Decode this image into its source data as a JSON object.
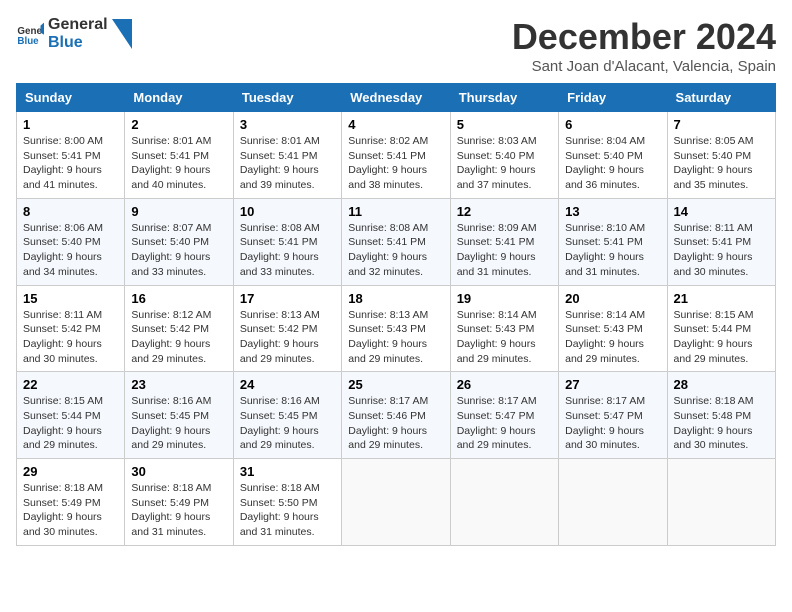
{
  "header": {
    "logo_general": "General",
    "logo_blue": "Blue",
    "month": "December 2024",
    "location": "Sant Joan d'Alacant, Valencia, Spain"
  },
  "days_of_week": [
    "Sunday",
    "Monday",
    "Tuesday",
    "Wednesday",
    "Thursday",
    "Friday",
    "Saturday"
  ],
  "weeks": [
    [
      {
        "day": "1",
        "sunrise": "Sunrise: 8:00 AM",
        "sunset": "Sunset: 5:41 PM",
        "daylight": "Daylight: 9 hours and 41 minutes."
      },
      {
        "day": "2",
        "sunrise": "Sunrise: 8:01 AM",
        "sunset": "Sunset: 5:41 PM",
        "daylight": "Daylight: 9 hours and 40 minutes."
      },
      {
        "day": "3",
        "sunrise": "Sunrise: 8:01 AM",
        "sunset": "Sunset: 5:41 PM",
        "daylight": "Daylight: 9 hours and 39 minutes."
      },
      {
        "day": "4",
        "sunrise": "Sunrise: 8:02 AM",
        "sunset": "Sunset: 5:41 PM",
        "daylight": "Daylight: 9 hours and 38 minutes."
      },
      {
        "day": "5",
        "sunrise": "Sunrise: 8:03 AM",
        "sunset": "Sunset: 5:40 PM",
        "daylight": "Daylight: 9 hours and 37 minutes."
      },
      {
        "day": "6",
        "sunrise": "Sunrise: 8:04 AM",
        "sunset": "Sunset: 5:40 PM",
        "daylight": "Daylight: 9 hours and 36 minutes."
      },
      {
        "day": "7",
        "sunrise": "Sunrise: 8:05 AM",
        "sunset": "Sunset: 5:40 PM",
        "daylight": "Daylight: 9 hours and 35 minutes."
      }
    ],
    [
      {
        "day": "8",
        "sunrise": "Sunrise: 8:06 AM",
        "sunset": "Sunset: 5:40 PM",
        "daylight": "Daylight: 9 hours and 34 minutes."
      },
      {
        "day": "9",
        "sunrise": "Sunrise: 8:07 AM",
        "sunset": "Sunset: 5:40 PM",
        "daylight": "Daylight: 9 hours and 33 minutes."
      },
      {
        "day": "10",
        "sunrise": "Sunrise: 8:08 AM",
        "sunset": "Sunset: 5:41 PM",
        "daylight": "Daylight: 9 hours and 33 minutes."
      },
      {
        "day": "11",
        "sunrise": "Sunrise: 8:08 AM",
        "sunset": "Sunset: 5:41 PM",
        "daylight": "Daylight: 9 hours and 32 minutes."
      },
      {
        "day": "12",
        "sunrise": "Sunrise: 8:09 AM",
        "sunset": "Sunset: 5:41 PM",
        "daylight": "Daylight: 9 hours and 31 minutes."
      },
      {
        "day": "13",
        "sunrise": "Sunrise: 8:10 AM",
        "sunset": "Sunset: 5:41 PM",
        "daylight": "Daylight: 9 hours and 31 minutes."
      },
      {
        "day": "14",
        "sunrise": "Sunrise: 8:11 AM",
        "sunset": "Sunset: 5:41 PM",
        "daylight": "Daylight: 9 hours and 30 minutes."
      }
    ],
    [
      {
        "day": "15",
        "sunrise": "Sunrise: 8:11 AM",
        "sunset": "Sunset: 5:42 PM",
        "daylight": "Daylight: 9 hours and 30 minutes."
      },
      {
        "day": "16",
        "sunrise": "Sunrise: 8:12 AM",
        "sunset": "Sunset: 5:42 PM",
        "daylight": "Daylight: 9 hours and 29 minutes."
      },
      {
        "day": "17",
        "sunrise": "Sunrise: 8:13 AM",
        "sunset": "Sunset: 5:42 PM",
        "daylight": "Daylight: 9 hours and 29 minutes."
      },
      {
        "day": "18",
        "sunrise": "Sunrise: 8:13 AM",
        "sunset": "Sunset: 5:43 PM",
        "daylight": "Daylight: 9 hours and 29 minutes."
      },
      {
        "day": "19",
        "sunrise": "Sunrise: 8:14 AM",
        "sunset": "Sunset: 5:43 PM",
        "daylight": "Daylight: 9 hours and 29 minutes."
      },
      {
        "day": "20",
        "sunrise": "Sunrise: 8:14 AM",
        "sunset": "Sunset: 5:43 PM",
        "daylight": "Daylight: 9 hours and 29 minutes."
      },
      {
        "day": "21",
        "sunrise": "Sunrise: 8:15 AM",
        "sunset": "Sunset: 5:44 PM",
        "daylight": "Daylight: 9 hours and 29 minutes."
      }
    ],
    [
      {
        "day": "22",
        "sunrise": "Sunrise: 8:15 AM",
        "sunset": "Sunset: 5:44 PM",
        "daylight": "Daylight: 9 hours and 29 minutes."
      },
      {
        "day": "23",
        "sunrise": "Sunrise: 8:16 AM",
        "sunset": "Sunset: 5:45 PM",
        "daylight": "Daylight: 9 hours and 29 minutes."
      },
      {
        "day": "24",
        "sunrise": "Sunrise: 8:16 AM",
        "sunset": "Sunset: 5:45 PM",
        "daylight": "Daylight: 9 hours and 29 minutes."
      },
      {
        "day": "25",
        "sunrise": "Sunrise: 8:17 AM",
        "sunset": "Sunset: 5:46 PM",
        "daylight": "Daylight: 9 hours and 29 minutes."
      },
      {
        "day": "26",
        "sunrise": "Sunrise: 8:17 AM",
        "sunset": "Sunset: 5:47 PM",
        "daylight": "Daylight: 9 hours and 29 minutes."
      },
      {
        "day": "27",
        "sunrise": "Sunrise: 8:17 AM",
        "sunset": "Sunset: 5:47 PM",
        "daylight": "Daylight: 9 hours and 30 minutes."
      },
      {
        "day": "28",
        "sunrise": "Sunrise: 8:18 AM",
        "sunset": "Sunset: 5:48 PM",
        "daylight": "Daylight: 9 hours and 30 minutes."
      }
    ],
    [
      {
        "day": "29",
        "sunrise": "Sunrise: 8:18 AM",
        "sunset": "Sunset: 5:49 PM",
        "daylight": "Daylight: 9 hours and 30 minutes."
      },
      {
        "day": "30",
        "sunrise": "Sunrise: 8:18 AM",
        "sunset": "Sunset: 5:49 PM",
        "daylight": "Daylight: 9 hours and 31 minutes."
      },
      {
        "day": "31",
        "sunrise": "Sunrise: 8:18 AM",
        "sunset": "Sunset: 5:50 PM",
        "daylight": "Daylight: 9 hours and 31 minutes."
      },
      null,
      null,
      null,
      null
    ]
  ]
}
